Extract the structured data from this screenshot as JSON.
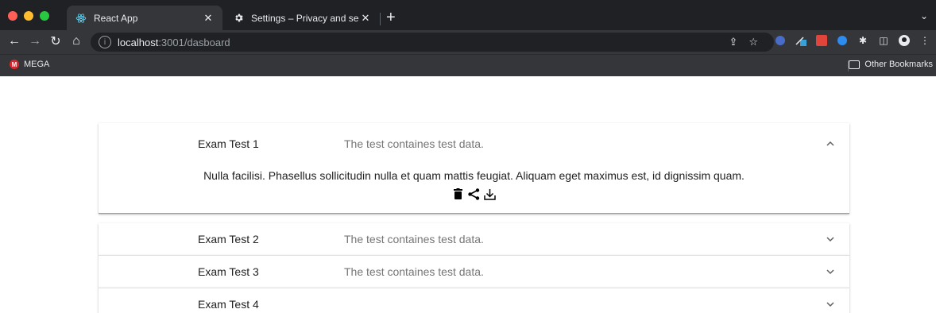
{
  "browser": {
    "tabs": [
      {
        "title": "React App",
        "active": true
      },
      {
        "title": "Settings – Privacy and security",
        "active": false
      }
    ],
    "url": {
      "host": "localhost",
      "rest": ":3001/dasboard"
    },
    "bookmarks": {
      "left": "MEGA",
      "right": "Other Bookmarks"
    }
  },
  "accordion": {
    "items": [
      {
        "title": "Exam Test 1",
        "description": "The test containes test data.",
        "expanded": true,
        "details": "Nulla facilisi. Phasellus sollicitudin nulla et quam mattis feugiat. Aliquam eget maximus est, id dignissim quam."
      },
      {
        "title": "Exam Test 2",
        "description": "The test containes test data.",
        "expanded": false
      },
      {
        "title": "Exam Test 3",
        "description": "The test containes test data.",
        "expanded": false
      },
      {
        "title": "Exam Test 4",
        "description": "",
        "expanded": false
      }
    ]
  },
  "icons": {
    "delete": "trash-icon",
    "share": "share-icon",
    "download": "download-icon",
    "expand_more": "chevron-down-icon",
    "expand_less": "chevron-up-icon"
  },
  "colors": {
    "chrome_bg": "#202124",
    "toolbar_bg": "#35363a",
    "text_secondary": "#757575"
  }
}
